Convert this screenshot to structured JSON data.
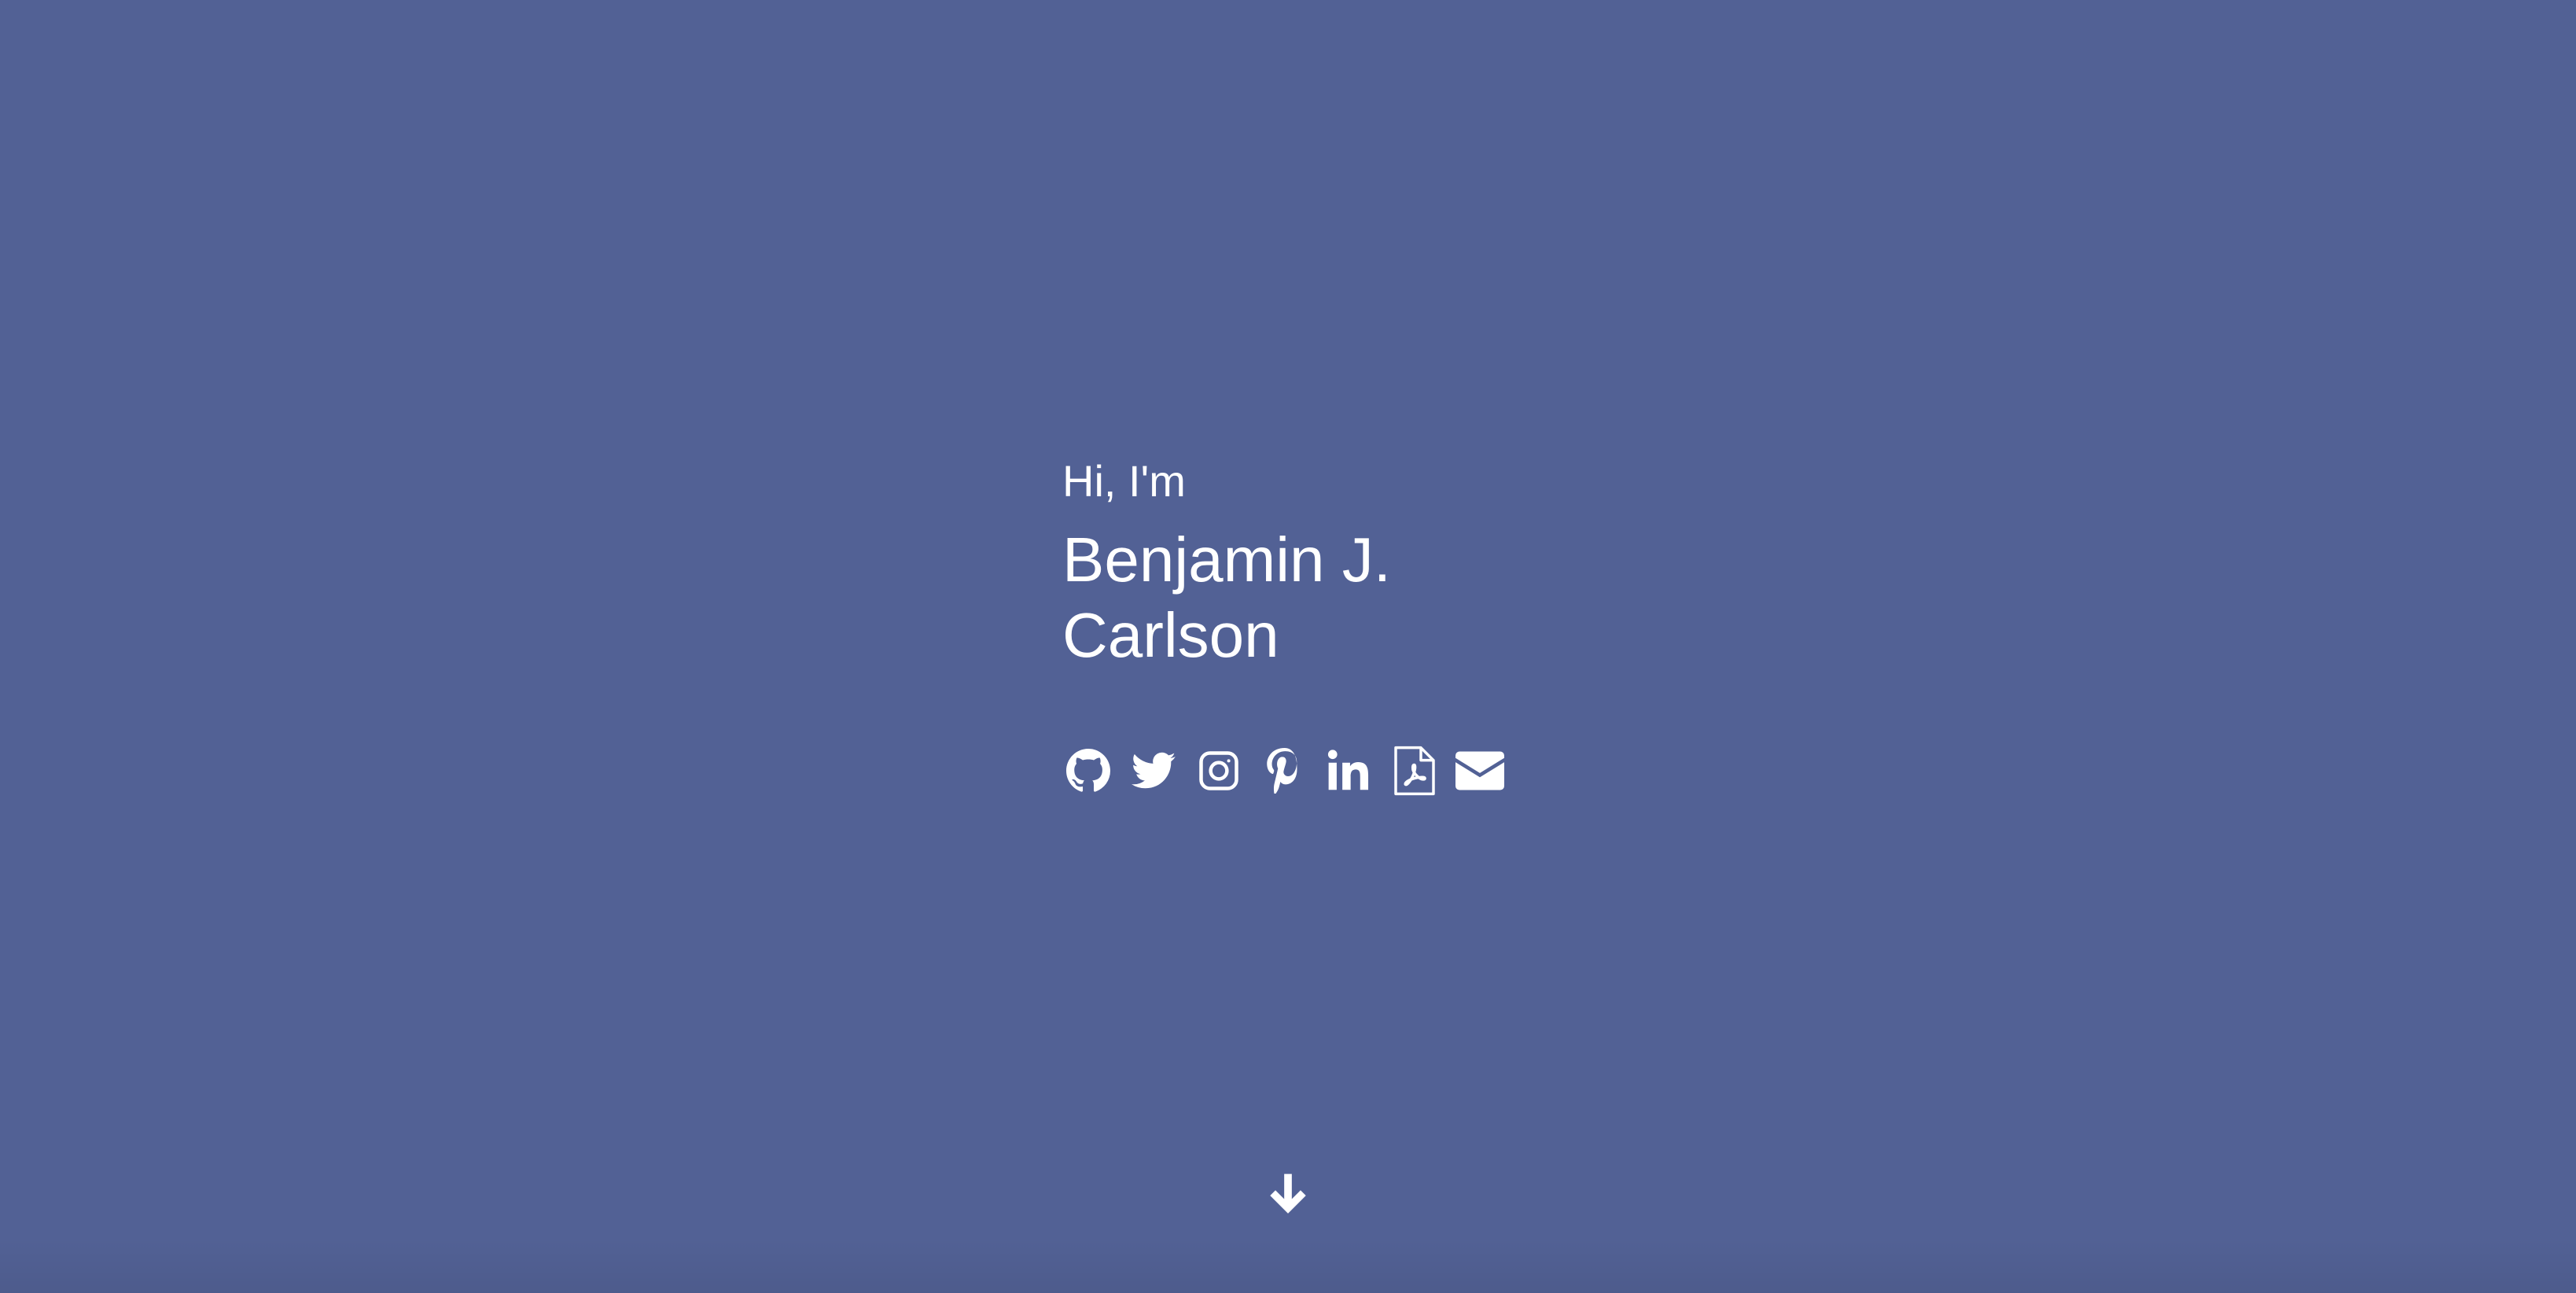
{
  "theme": {
    "background": "#526195",
    "foreground": "#ffffff"
  },
  "hero": {
    "greeting": "Hi, I'm",
    "name_line1": "Benjamin J.",
    "name_line2": "Carlson"
  },
  "social_links": [
    {
      "icon": "github-icon"
    },
    {
      "icon": "twitter-icon"
    },
    {
      "icon": "instagram-icon"
    },
    {
      "icon": "pinterest-icon"
    },
    {
      "icon": "linkedin-icon"
    },
    {
      "icon": "pdf-file-icon"
    },
    {
      "icon": "envelope-icon"
    }
  ],
  "scroll": {
    "icon": "arrow-down-icon"
  }
}
